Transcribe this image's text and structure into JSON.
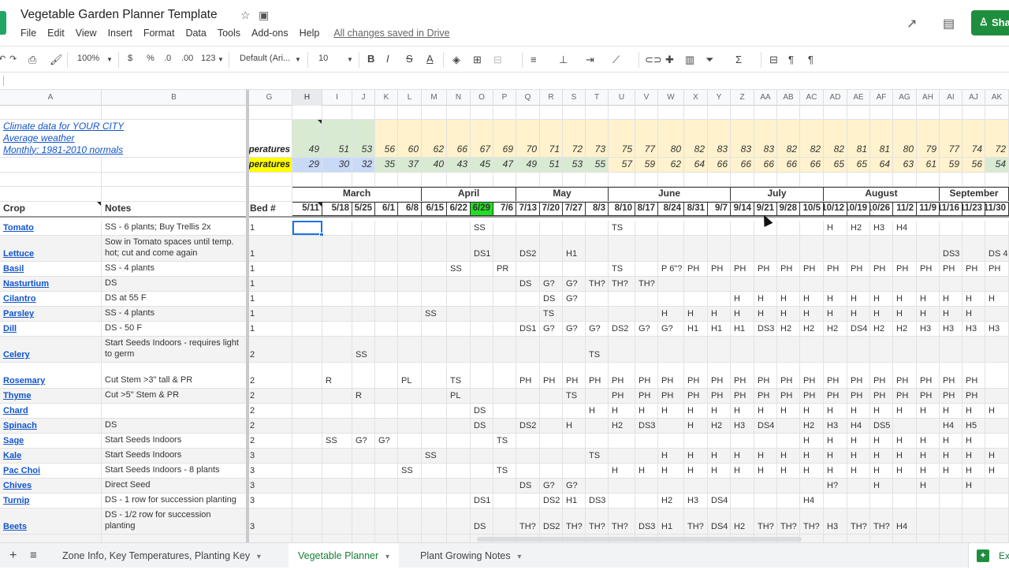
{
  "app": {
    "title": "Vegetable Garden Planner Template",
    "menu": [
      "File",
      "Edit",
      "View",
      "Insert",
      "Format",
      "Data",
      "Tools",
      "Add-ons",
      "Help"
    ],
    "save_status": "All changes saved in Drive",
    "share_label": "Share",
    "share_visible_text": "Sha"
  },
  "toolbar": {
    "zoom": "100%",
    "currency": "$",
    "percent": "%",
    "dec_decrease": ".0",
    "dec_increase": ".00",
    "format_more": "123",
    "font": "Default (Ari...",
    "font_size": "10",
    "bold": "B",
    "italic": "I",
    "strike": "S",
    "text_color": "A"
  },
  "columns": [
    "A",
    "B",
    "G",
    "H",
    "I",
    "J",
    "K",
    "L",
    "M",
    "N",
    "O",
    "P",
    "Q",
    "R",
    "S",
    "T",
    "U",
    "V",
    "W",
    "X",
    "Y",
    "Z",
    "AA",
    "AB",
    "AC",
    "AD",
    "AE",
    "AF",
    "AG",
    "AH",
    "AI",
    "AJ",
    "AK"
  ],
  "selected_column": "H",
  "climate": {
    "line1": "Climate data for YOUR CITY",
    "line2": "Average weather",
    "line3": "Monthly: 1981-2010 normals",
    "high_label": "peratures",
    "low_label": "peratures",
    "high_temps": [
      49,
      51,
      53,
      56,
      60,
      62,
      66,
      67,
      69,
      70,
      71,
      72,
      73,
      75,
      77,
      80,
      82,
      83,
      83,
      83,
      82,
      82,
      82,
      81,
      81,
      80,
      79,
      77,
      74,
      72
    ],
    "low_temps": [
      29,
      30,
      32,
      35,
      37,
      40,
      43,
      45,
      47,
      49,
      51,
      53,
      55,
      57,
      59,
      62,
      64,
      66,
      66,
      66,
      66,
      66,
      65,
      65,
      64,
      63,
      61,
      59,
      56,
      54
    ]
  },
  "header": {
    "crop": "Crop",
    "notes": "Notes",
    "bed": "Bed #",
    "months": [
      {
        "name": "March",
        "span": 5
      },
      {
        "name": "April",
        "span": 4
      },
      {
        "name": "May",
        "span": 4
      },
      {
        "name": "June",
        "span": 5
      },
      {
        "name": "July",
        "span": 4
      },
      {
        "name": "August",
        "span": 5
      },
      {
        "name": "September",
        "span": 3
      }
    ],
    "dates": [
      "5/11",
      "5/18",
      "5/25",
      "6/1",
      "6/8",
      "6/15",
      "6/22",
      "6/29",
      "7/6",
      "7/13",
      "7/20",
      "7/27",
      "8/3",
      "8/10",
      "8/17",
      "8/24",
      "8/31",
      "9/7",
      "9/14",
      "9/21",
      "9/28",
      "10/5",
      "10/12",
      "10/19",
      "10/26",
      "11/2",
      "11/9",
      "11/16",
      "11/23",
      "11/30"
    ],
    "highlighted_date": "6/29",
    "highlight_color": "#22dd22"
  },
  "colors": {
    "cool_green": "#d9ead3",
    "warm_yellow": "#fff2cc",
    "cold_blue": "#c9daf8",
    "label_yellow": "#ffff00",
    "link_blue": "#1155cc",
    "sheet_green": "#188038"
  },
  "crops": [
    {
      "crop": "Tomato",
      "notes": "SS - 6 plants; Buy Trellis 2x",
      "bed": "1",
      "tall": false,
      "schedule": [
        "",
        "",
        "",
        "",
        "",
        "",
        "",
        "SS",
        "",
        "",
        "",
        "",
        "",
        "TS",
        "",
        "",
        "",
        "",
        "",
        "",
        "",
        "",
        "H",
        "H2",
        "H3",
        "H4",
        "",
        "",
        "",
        ""
      ]
    },
    {
      "crop": "Lettuce",
      "notes": "Sow in Tomato spaces until temp. hot; cut and come again",
      "bed": "1",
      "tall": true,
      "schedule": [
        "",
        "",
        "",
        "",
        "",
        "",
        "",
        "DS1",
        "",
        "DS2",
        "",
        "H1",
        "",
        "",
        "",
        "",
        "",
        "",
        "",
        "",
        "",
        "",
        "",
        "",
        "",
        "",
        "",
        "DS3",
        "",
        "DS 4"
      ]
    },
    {
      "crop": "Basil",
      "notes": "SS - 4 plants",
      "bed": "1",
      "tall": false,
      "schedule": [
        "",
        "",
        "",
        "",
        "",
        "",
        "SS",
        "",
        "PR",
        "",
        "",
        "",
        "",
        "TS",
        "",
        "P 6\"?",
        "PH",
        "PH",
        "PH",
        "PH",
        "PH",
        "PH",
        "PH",
        "PH",
        "PH",
        "PH",
        "PH",
        "PH",
        "PH",
        "PH"
      ]
    },
    {
      "crop": "Nasturtium",
      "notes": "DS",
      "bed": "1",
      "tall": false,
      "schedule": [
        "",
        "",
        "",
        "",
        "",
        "",
        "",
        "",
        "",
        "DS",
        "G?",
        "G?",
        "TH?",
        "TH?",
        "TH?",
        "",
        "",
        "",
        "",
        "",
        "",
        "",
        "",
        "",
        "",
        "",
        "",
        "",
        "",
        ""
      ]
    },
    {
      "crop": "Cilantro",
      "notes": "DS at 55 F",
      "bed": "1",
      "tall": false,
      "schedule": [
        "",
        "",
        "",
        "",
        "",
        "",
        "",
        "",
        "",
        "",
        "DS",
        "G?",
        "",
        "",
        "",
        "",
        "",
        "",
        "H",
        "H",
        "H",
        "H",
        "H",
        "H",
        "H",
        "H",
        "H",
        "H",
        "H",
        "H"
      ]
    },
    {
      "crop": "Parsley",
      "notes": "SS - 4 plants",
      "bed": "1",
      "tall": false,
      "schedule": [
        "",
        "",
        "",
        "",
        "",
        "SS",
        "",
        "",
        "",
        "",
        "TS",
        "",
        "",
        "",
        "",
        "H",
        "H",
        "H",
        "H",
        "H",
        "H",
        "H",
        "H",
        "H",
        "H",
        "H",
        "H",
        "H",
        "H",
        ""
      ]
    },
    {
      "crop": "Dill",
      "notes": "DS - 50 F",
      "bed": "1",
      "tall": false,
      "schedule": [
        "",
        "",
        "",
        "",
        "",
        "",
        "",
        "",
        "",
        "DS1",
        "G?",
        "G?",
        "G?",
        "DS2",
        "G?",
        "G?",
        "H1",
        "H1",
        "H1",
        "DS3",
        "H2",
        "H2",
        "H2",
        "DS4",
        "H2",
        "H2",
        "H3",
        "H3",
        "H3",
        "H3"
      ]
    },
    {
      "crop": "Celery",
      "notes": "Start Seeds Indoors - requires light to germ",
      "bed": "2",
      "tall": true,
      "schedule": [
        "",
        "",
        "SS",
        "",
        "",
        "",
        "",
        "",
        "",
        "",
        "",
        "",
        "TS",
        "",
        "",
        "",
        "",
        "",
        "",
        "",
        "",
        "",
        "",
        "",
        "",
        "",
        "",
        "",
        "",
        ""
      ]
    },
    {
      "crop": "Rosemary",
      "notes": "Cut Stem >3\" tall & PR",
      "bed": "2",
      "tall": true,
      "schedule": [
        "",
        "R",
        "",
        "",
        "PL",
        "",
        "TS",
        "",
        "",
        "PH",
        "PH",
        "PH",
        "PH",
        "PH",
        "PH",
        "PH",
        "PH",
        "PH",
        "PH",
        "PH",
        "PH",
        "PH",
        "PH",
        "PH",
        "PH",
        "PH",
        "PH",
        "PH",
        "PH",
        ""
      ]
    },
    {
      "crop": "Thyme",
      "notes": "Cut >5\" Stem & PR",
      "bed": "2",
      "tall": false,
      "schedule": [
        "",
        "",
        "R",
        "",
        "",
        "",
        "PL",
        "",
        "",
        "",
        "",
        "TS",
        "",
        "PH",
        "PH",
        "PH",
        "PH",
        "PH",
        "PH",
        "PH",
        "PH",
        "PH",
        "PH",
        "PH",
        "PH",
        "PH",
        "PH",
        "PH",
        "PH",
        ""
      ]
    },
    {
      "crop": "Chard",
      "notes": "",
      "bed": "2",
      "tall": false,
      "schedule": [
        "",
        "",
        "",
        "",
        "",
        "",
        "",
        "DS",
        "",
        "",
        "",
        "",
        "H",
        "H",
        "H",
        "H",
        "H",
        "H",
        "H",
        "H",
        "H",
        "H",
        "H",
        "H",
        "H",
        "H",
        "H",
        "H",
        "H",
        "H"
      ]
    },
    {
      "crop": "Spinach",
      "notes": "DS",
      "bed": "2",
      "tall": false,
      "schedule": [
        "",
        "",
        "",
        "",
        "",
        "",
        "",
        "DS",
        "",
        "DS2",
        "",
        "H",
        "",
        "H2",
        "DS3",
        "",
        "H",
        "H2",
        "H3",
        "DS4",
        "",
        "H2",
        "H3",
        "H4",
        "DS5",
        "",
        "",
        "H4",
        "H5",
        ""
      ]
    },
    {
      "crop": "Sage",
      "notes": "Start Seeds Indoors",
      "bed": "2",
      "tall": false,
      "schedule": [
        "",
        "SS",
        "G?",
        "G?",
        "",
        "",
        "",
        "",
        "TS",
        "",
        "",
        "",
        "",
        "",
        "",
        "",
        "",
        "",
        "",
        "",
        "",
        "H",
        "H",
        "H",
        "H",
        "H",
        "H",
        "H",
        "H",
        ""
      ]
    },
    {
      "crop": "Kale",
      "notes": "Start Seeds Indoors",
      "bed": "3",
      "tall": false,
      "schedule": [
        "",
        "",
        "",
        "",
        "",
        "SS",
        "",
        "",
        "",
        "",
        "",
        "",
        "TS",
        "",
        "",
        "H",
        "H",
        "H",
        "H",
        "H",
        "H",
        "H",
        "H",
        "H",
        "H",
        "H",
        "H",
        "H",
        "H",
        "H"
      ]
    },
    {
      "crop": "Pac Choi",
      "notes": "Start Seeds Indoors - 8 plants",
      "bed": "3",
      "tall": false,
      "schedule": [
        "",
        "",
        "",
        "",
        "SS",
        "",
        "",
        "",
        "TS",
        "",
        "",
        "",
        "",
        "H",
        "H",
        "H",
        "H",
        "H",
        "H",
        "H",
        "H",
        "H",
        "H",
        "H",
        "H",
        "H",
        "H",
        "H",
        "H",
        "H"
      ]
    },
    {
      "crop": "Chives",
      "notes": "Direct Seed",
      "bed": "3",
      "tall": false,
      "schedule": [
        "",
        "",
        "",
        "",
        "",
        "",
        "",
        "",
        "",
        "DS",
        "G?",
        "G?",
        "",
        "",
        "",
        "",
        "",
        "",
        "",
        "",
        "",
        "",
        "H?",
        "",
        "H",
        "",
        "H",
        "",
        "H",
        ""
      ]
    },
    {
      "crop": "Turnip",
      "notes": "DS - 1 row for succession planting",
      "bed": "3",
      "tall": false,
      "schedule": [
        "",
        "",
        "",
        "",
        "",
        "",
        "",
        "DS1",
        "",
        "",
        "DS2",
        "H1",
        "DS3",
        "",
        "",
        "H2",
        "H3",
        "DS4",
        "",
        "",
        "",
        "H4",
        "",
        "",
        "",
        "",
        "",
        "",
        "",
        ""
      ]
    },
    {
      "crop": "Beets",
      "notes": "DS - 1/2 row for succession planting",
      "bed": "3",
      "tall": true,
      "schedule": [
        "",
        "",
        "",
        "",
        "",
        "",
        "",
        "DS",
        "",
        "TH?",
        "DS2",
        "TH?",
        "TH?",
        "TH?",
        "DS3",
        "H1",
        "TH?",
        "DS4",
        "H2",
        "TH?",
        "TH?",
        "TH?",
        "H3",
        "TH?",
        "TH?",
        "H4",
        "",
        "",
        "",
        ""
      ]
    }
  ],
  "sheets": {
    "tabs": [
      "Zone Info, Key Temperatures, Planting Key",
      "Vegetable Planner",
      "Plant Growing Notes"
    ],
    "active": "Vegetable Planner",
    "add_label": "+",
    "list_label": "≡",
    "explore_label": "Explore"
  }
}
